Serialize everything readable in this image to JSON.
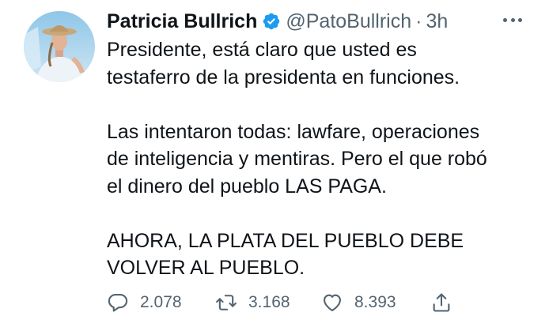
{
  "author": {
    "name": "Patricia Bullrich",
    "handle": "@PatoBullrich",
    "separator": "·",
    "time": "3h"
  },
  "tweet": {
    "lines": [
      "Presidente, está claro que usted es",
      "testaferro de la presidenta en funciones.",
      "",
      "Las intentaron todas: lawfare, operaciones",
      "de inteligencia y mentiras. Pero el que robó",
      "el dinero del pueblo LAS PAGA.",
      "",
      "AHORA, LA PLATA DEL PUEBLO DEBE",
      "VOLVER AL PUEBLO."
    ]
  },
  "actions": {
    "reply_count": "2.078",
    "retweet_count": "3.168",
    "like_count": "8.393"
  },
  "icons": {
    "verified": "verified-badge-icon",
    "reply": "reply-icon",
    "retweet": "retweet-icon",
    "like": "like-icon",
    "share": "share-icon",
    "more": "more-icon"
  },
  "colors": {
    "text": "#0f1419",
    "secondary": "#536471",
    "verified": "#1d9bf0"
  }
}
